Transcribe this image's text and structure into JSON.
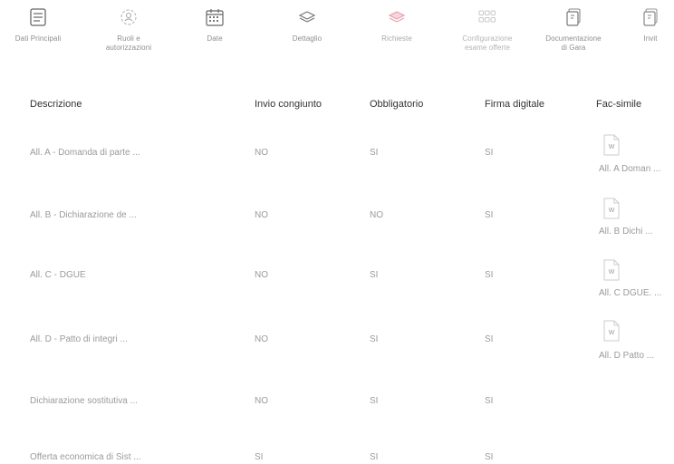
{
  "nav": {
    "steps": [
      {
        "label": "Dati Principali",
        "icon": "list-document-icon"
      },
      {
        "label": "Ruoli e\nautorizzazioni",
        "icon": "user-settings-icon"
      },
      {
        "label": "Date",
        "icon": "calendar-icon"
      },
      {
        "label": "Dettaglio",
        "icon": "layers-icon"
      },
      {
        "label": "Richieste",
        "icon": "layers-pink-icon"
      },
      {
        "label": "Configurazione\nesame offerte",
        "icon": "grid-icon"
      },
      {
        "label": "Documentazione\ndi Gara",
        "icon": "documents-icon"
      },
      {
        "label": "Invit",
        "icon": "document-icon"
      }
    ]
  },
  "table": {
    "headers": {
      "descrizione": "Descrizione",
      "invio": "Invio congiunto",
      "obbligatorio": "Obbligatorio",
      "firma": "Firma digitale",
      "facsimile": "Fac-simile"
    },
    "rows": [
      {
        "descrizione": "All. A - Domanda di parte ...",
        "invio": "NO",
        "obbligatorio": "SI",
        "firma": "SI",
        "facsimile": "All. A Doman ..."
      },
      {
        "descrizione": "All. B - Dichiarazione de ...",
        "invio": "NO",
        "obbligatorio": "NO",
        "firma": "SI",
        "facsimile": "All. B Dichi ..."
      },
      {
        "descrizione": "All. C - DGUE",
        "invio": "NO",
        "obbligatorio": "SI",
        "firma": "SI",
        "facsimile": "All. C DGUE. ..."
      },
      {
        "descrizione": "All. D - Patto di integri ...",
        "invio": "NO",
        "obbligatorio": "SI",
        "firma": "SI",
        "facsimile": "All. D Patto ..."
      },
      {
        "descrizione": "Dichiarazione sostitutiva ...",
        "invio": "NO",
        "obbligatorio": "SI",
        "firma": "SI",
        "facsimile": ""
      },
      {
        "descrizione": "Offerta economica di Sist ...",
        "invio": "SI",
        "obbligatorio": "SI",
        "firma": "SI",
        "facsimile": ""
      }
    ]
  },
  "colors": {
    "text_dark": "#333333",
    "text_muted": "#9a9a9a",
    "accent_pink": "#e8a0ad"
  }
}
